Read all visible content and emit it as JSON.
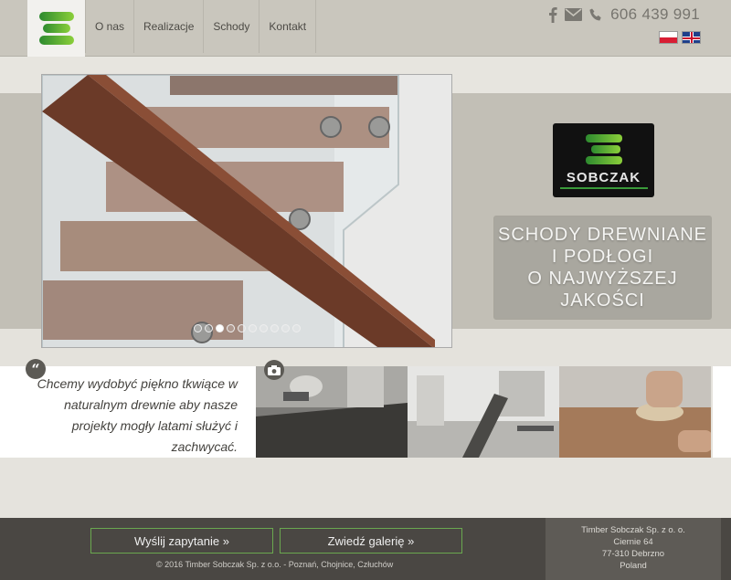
{
  "header": {
    "nav": [
      {
        "label": "O nas"
      },
      {
        "label": "Realizacje"
      },
      {
        "label": "Schody"
      },
      {
        "label": "Kontakt"
      }
    ],
    "phone": "606 439 991",
    "icons": [
      "facebook-icon",
      "mail-icon",
      "phone-icon"
    ],
    "languages": [
      "polish-flag",
      "english-flag"
    ]
  },
  "slider": {
    "dot_count": 10,
    "active_index": 2
  },
  "brand": {
    "name": "SOBCZAK"
  },
  "hero": {
    "headline": "SCHODY DREWNIANE\nI PODŁOGI\nO NAJWYŻSZEJ\nJAKOŚCI"
  },
  "quote": {
    "text": "Chcemy wydobyć piękno tkwiące w naturalnym drewnie aby nasze projekty mogły latami służyć i zachwycać."
  },
  "footer": {
    "button_inquiry": "Wyślij zapytanie »",
    "button_gallery": "Zwiedź galerię »",
    "copyright": "© 2016 Timber Sobczak Sp. z o.o. - Poznań, Chojnice, Człuchów",
    "address": [
      "Timber Sobczak Sp. z o. o.",
      "Ciernie 64",
      "77-310 Debrzno",
      "Poland"
    ]
  },
  "colors": {
    "header_bg": "#c9c6bd",
    "band_bg": "#c2bfb6",
    "footer_bg": "#4a4743",
    "accent_green": "#6aa84f"
  }
}
